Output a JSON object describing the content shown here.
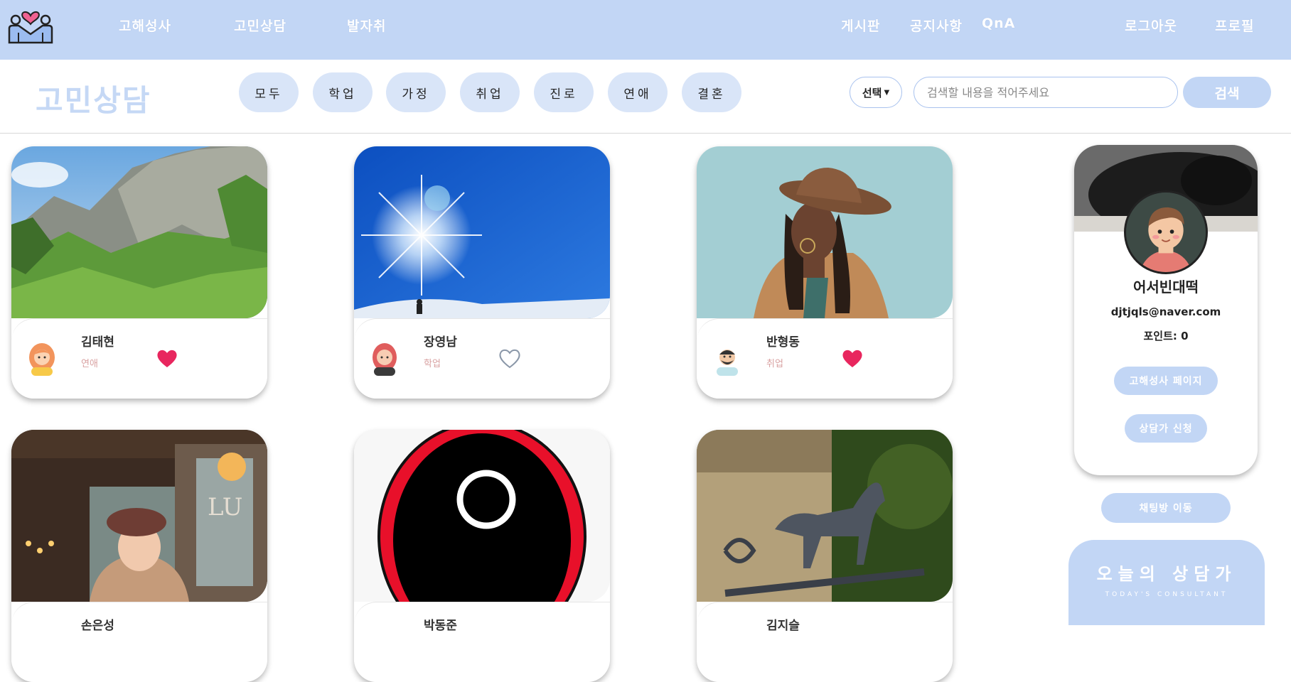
{
  "nav": {
    "left": [
      "고해성사",
      "고민상담",
      "발자취"
    ],
    "center": [
      "게시판",
      "공지사항",
      "QnA"
    ],
    "right": [
      "로그아웃",
      "프로필"
    ]
  },
  "page_title": "고민상담",
  "categories": [
    "모두",
    "학업",
    "가정",
    "취업",
    "진로",
    "연애",
    "결혼"
  ],
  "search": {
    "select_label": "선택",
    "placeholder": "검색할 내용을 적어주세요",
    "button_label": "검색"
  },
  "cards": [
    {
      "name": "김태현",
      "category": "연애",
      "liked": true,
      "image": "mountain"
    },
    {
      "name": "장영남",
      "category": "학업",
      "liked": false,
      "image": "sky"
    },
    {
      "name": "반형동",
      "category": "취업",
      "liked": true,
      "image": "woman-hat"
    },
    {
      "name": "손은성",
      "category": "",
      "liked": false,
      "image": "cafe"
    },
    {
      "name": "박동준",
      "category": "",
      "liked": false,
      "image": "mask"
    },
    {
      "name": "김지슬",
      "category": "",
      "liked": false,
      "image": "horse"
    }
  ],
  "profile": {
    "nickname": "어서빈대떡",
    "email": "djtjqls@naver.com",
    "points_label": "포인트: 0",
    "confession_page_button": "고해성사 페이지",
    "counselor_apply_button": "상담가 신청"
  },
  "chat_button": "채팅방 이동",
  "today_consultant": {
    "title": "오늘의 상담가",
    "subtitle": "TODAY'S CONSULTANT"
  },
  "colors": {
    "accent": "#c2d6f5",
    "chip": "#d9e5f8",
    "heart": "#e8265e"
  }
}
